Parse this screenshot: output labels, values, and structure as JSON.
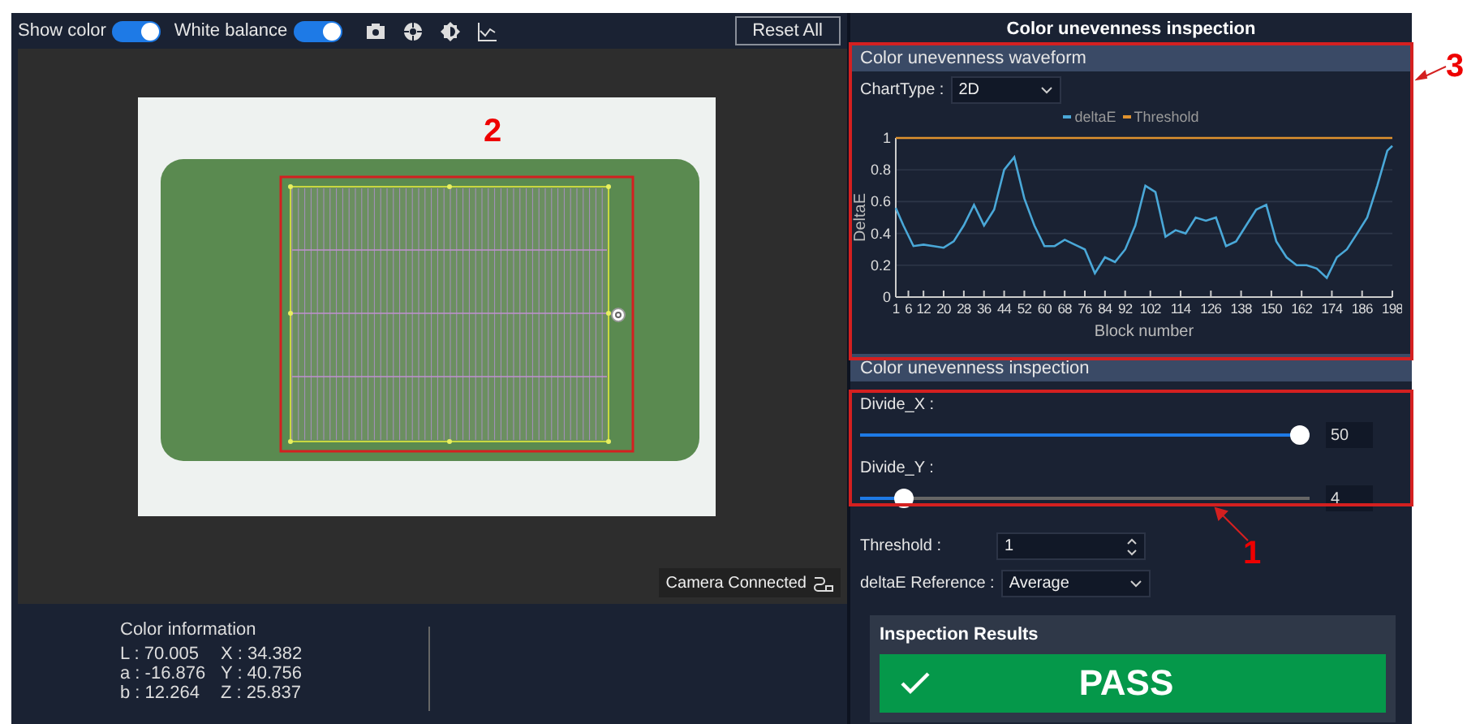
{
  "toolbar": {
    "toggles": [
      {
        "label": "Show color",
        "on": true
      },
      {
        "label": "White balance",
        "on": true
      }
    ],
    "reset_button": "Reset All"
  },
  "viewer": {
    "status": "Camera Connected"
  },
  "color_info": {
    "title": "Color information",
    "rows": [
      [
        "L : 70.005",
        "X : 34.382"
      ],
      [
        "a : -16.876",
        "Y : 40.756"
      ],
      [
        "b : 12.264",
        "Z : 25.837"
      ]
    ]
  },
  "panel": {
    "title": "Color unevenness inspection",
    "waveform": {
      "title": "Color unevenness waveform",
      "chart_type_label": "ChartType :",
      "chart_type_value": "2D",
      "chart_data": {
        "type": "line",
        "xlabel": "Block number",
        "ylabel": "DeltaE",
        "x": [
          1,
          4,
          8,
          12,
          16,
          20,
          24,
          28,
          32,
          36,
          40,
          44,
          48,
          52,
          56,
          60,
          64,
          68,
          72,
          76,
          80,
          84,
          88,
          92,
          96,
          100,
          104,
          108,
          112,
          116,
          120,
          124,
          128,
          132,
          136,
          140,
          144,
          148,
          152,
          156,
          160,
          164,
          168,
          172,
          176,
          180,
          184,
          188,
          192,
          196,
          198
        ],
        "series": [
          {
            "name": "deltaE",
            "color": "#4aa8d8",
            "values": [
              0.56,
              0.45,
              0.32,
              0.33,
              0.32,
              0.31,
              0.35,
              0.45,
              0.58,
              0.45,
              0.55,
              0.8,
              0.88,
              0.62,
              0.45,
              0.32,
              0.32,
              0.36,
              0.33,
              0.3,
              0.15,
              0.25,
              0.22,
              0.3,
              0.45,
              0.7,
              0.66,
              0.38,
              0.42,
              0.4,
              0.5,
              0.48,
              0.5,
              0.32,
              0.35,
              0.45,
              0.55,
              0.58,
              0.35,
              0.25,
              0.2,
              0.2,
              0.18,
              0.12,
              0.25,
              0.3,
              0.4,
              0.5,
              0.7,
              0.92,
              0.95
            ]
          },
          {
            "name": "Threshold",
            "color": "#e0922e",
            "values": [
              1,
              1,
              1,
              1,
              1,
              1,
              1,
              1,
              1,
              1,
              1,
              1,
              1,
              1,
              1,
              1,
              1,
              1,
              1,
              1,
              1,
              1,
              1,
              1,
              1,
              1,
              1,
              1,
              1,
              1,
              1,
              1,
              1,
              1,
              1,
              1,
              1,
              1,
              1,
              1,
              1,
              1,
              1,
              1,
              1,
              1,
              1,
              1,
              1,
              1,
              1
            ]
          }
        ],
        "xlim": [
          1,
          198
        ],
        "ylim": [
          0,
          1
        ],
        "xticks": [
          1,
          6,
          12,
          20,
          28,
          36,
          44,
          52,
          60,
          68,
          76,
          84,
          92,
          102,
          114,
          126,
          138,
          150,
          162,
          174,
          186,
          198
        ],
        "yticks": [
          0,
          0.2,
          0.4,
          0.6,
          0.8,
          1
        ],
        "grid": true
      }
    },
    "inspection": {
      "title": "Color unevenness inspection",
      "sliders": [
        {
          "label": "Divide_X :",
          "level": 1,
          "value": "50"
        },
        {
          "label": "Divide_Y :",
          "level": 0.08,
          "value": "4"
        }
      ],
      "threshold": {
        "label": "Threshold :",
        "value": "1"
      },
      "reference": {
        "label": "deltaE Reference :",
        "value": "Average"
      }
    },
    "results": {
      "title": "Inspection Results",
      "verdict": "PASS"
    }
  },
  "callouts": [
    {
      "label": "2"
    },
    {
      "label": "3"
    },
    {
      "label": "1"
    }
  ]
}
